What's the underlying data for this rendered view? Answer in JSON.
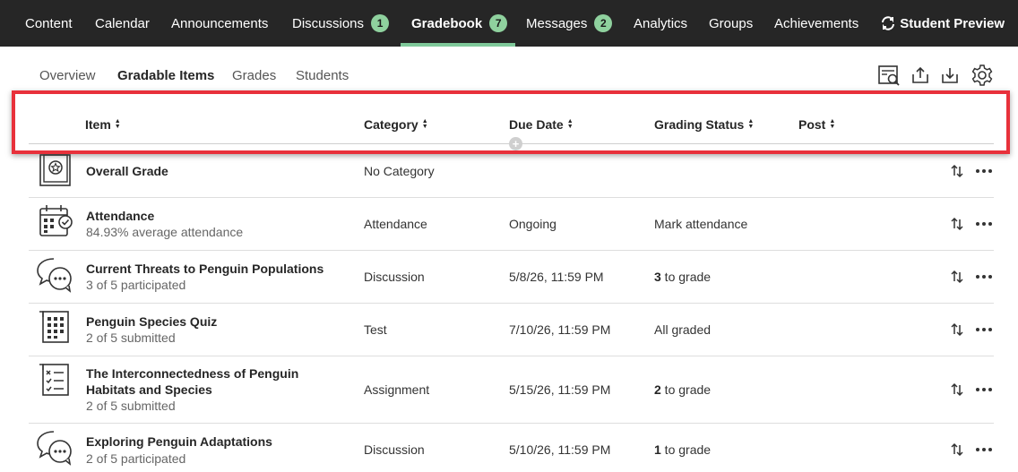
{
  "nav": {
    "items": [
      {
        "label": "Content",
        "badge": ""
      },
      {
        "label": "Calendar",
        "badge": ""
      },
      {
        "label": "Announcements",
        "badge": ""
      },
      {
        "label": "Discussions",
        "badge": "1"
      },
      {
        "label": "Gradebook",
        "badge": "7"
      },
      {
        "label": "Messages",
        "badge": "2"
      },
      {
        "label": "Analytics",
        "badge": ""
      },
      {
        "label": "Groups",
        "badge": ""
      },
      {
        "label": "Achievements",
        "badge": ""
      }
    ],
    "active": "Gradebook",
    "student_preview": "Student Preview"
  },
  "subtabs": [
    "Overview",
    "Gradable Items",
    "Grades",
    "Students"
  ],
  "subtab_active": "Gradable Items",
  "toolbar_icons": [
    "grade-search-icon",
    "upload-icon",
    "download-icon",
    "settings-gear-icon"
  ],
  "columns": [
    "Item",
    "Category",
    "Due Date",
    "Grading Status",
    "Post"
  ],
  "rows": [
    {
      "icon": "overall-grade-icon",
      "title": "Overall Grade",
      "subtitle": "",
      "category": "No Category",
      "due": "",
      "status_num": "",
      "status": ""
    },
    {
      "icon": "attendance-calendar-icon",
      "title": "Attendance",
      "subtitle": "84.93% average attendance",
      "category": "Attendance",
      "due": "Ongoing",
      "status_num": "",
      "status": "Mark attendance"
    },
    {
      "icon": "discussion-icon",
      "title": "Current Threats to Penguin Populations",
      "subtitle": "3 of 5 participated",
      "category": "Discussion",
      "due": "5/8/26, 11:59 PM",
      "status_num": "3",
      "status": " to grade"
    },
    {
      "icon": "test-icon",
      "title": "Penguin Species Quiz",
      "subtitle": "2 of 5 submitted",
      "category": "Test",
      "due": "7/10/26, 11:59 PM",
      "status_num": "",
      "status": "All graded"
    },
    {
      "icon": "assignment-icon",
      "title": "The Interconnectedness of Penguin Habitats and Species",
      "subtitle": "2 of 5 submitted",
      "category": "Assignment",
      "due": "5/15/26, 11:59 PM",
      "status_num": "2",
      "status": " to grade"
    },
    {
      "icon": "discussion-icon",
      "title": "Exploring Penguin Adaptations",
      "subtitle": "2 of 5 participated",
      "category": "Discussion",
      "due": "5/10/26, 11:59 PM",
      "status_num": "1",
      "status": " to grade"
    }
  ],
  "colors": {
    "nav_bg": "#262626",
    "badge": "#8fd19e",
    "highlight": "#e8313b"
  }
}
